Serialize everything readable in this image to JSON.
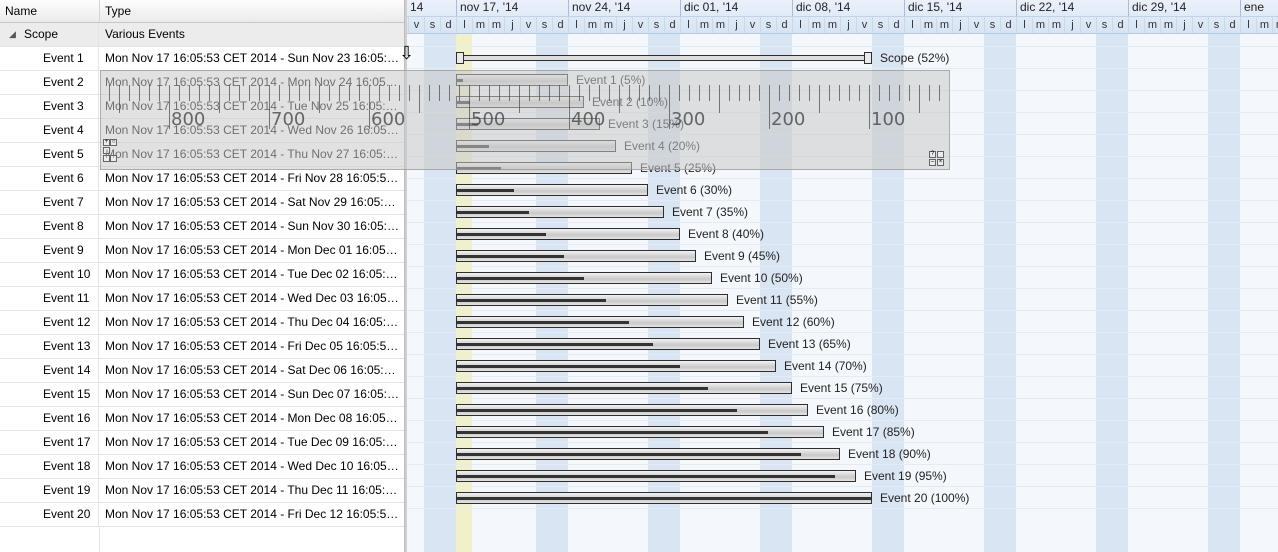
{
  "grid": {
    "columns": {
      "name": "Name",
      "type": "Type"
    },
    "summary": {
      "name": "Scope",
      "type": "Various Events"
    },
    "rows": [
      {
        "name": "Event 1",
        "type": "Mon Nov 17 16:05:53 CET 2014 - Sun Nov 23 16:05:53 ..."
      },
      {
        "name": "Event 2",
        "type": "Mon Nov 17 16:05:53 CET 2014 - Mon Nov 24 16:05:53..."
      },
      {
        "name": "Event 3",
        "type": "Mon Nov 17 16:05:53 CET 2014 - Tue Nov 25 16:05:53 ..."
      },
      {
        "name": "Event 4",
        "type": "Mon Nov 17 16:05:53 CET 2014 - Wed Nov 26 16:05:53 ..."
      },
      {
        "name": "Event 5",
        "type": "Mon Nov 17 16:05:53 CET 2014 - Thu Nov 27 16:05:53 ..."
      },
      {
        "name": "Event 6",
        "type": "Mon Nov 17 16:05:53 CET 2014 - Fri Nov 28 16:05:53 C..."
      },
      {
        "name": "Event 7",
        "type": "Mon Nov 17 16:05:53 CET 2014 - Sat Nov 29 16:05:53 ..."
      },
      {
        "name": "Event 8",
        "type": "Mon Nov 17 16:05:53 CET 2014 - Sun Nov 30 16:05:53 ..."
      },
      {
        "name": "Event 9",
        "type": "Mon Nov 17 16:05:53 CET 2014 - Mon Dec 01 16:05:53 ..."
      },
      {
        "name": "Event 10",
        "type": "Mon Nov 17 16:05:53 CET 2014 - Tue Dec 02 16:05:53 ..."
      },
      {
        "name": "Event 11",
        "type": "Mon Nov 17 16:05:53 CET 2014 - Wed Dec 03 16:05:53 ..."
      },
      {
        "name": "Event 12",
        "type": "Mon Nov 17 16:05:53 CET 2014 - Thu Dec 04 16:05:53 ..."
      },
      {
        "name": "Event 13",
        "type": "Mon Nov 17 16:05:53 CET 2014 - Fri Dec 05 16:05:53 C..."
      },
      {
        "name": "Event 14",
        "type": "Mon Nov 17 16:05:53 CET 2014 - Sat Dec 06 16:05:53 C..."
      },
      {
        "name": "Event 15",
        "type": "Mon Nov 17 16:05:53 CET 2014 - Sun Dec 07 16:05:53 ..."
      },
      {
        "name": "Event 16",
        "type": "Mon Nov 17 16:05:53 CET 2014 - Mon Dec 08 16:05:53 ..."
      },
      {
        "name": "Event 17",
        "type": "Mon Nov 17 16:05:53 CET 2014 - Tue Dec 09 16:05:53 ..."
      },
      {
        "name": "Event 18",
        "type": "Mon Nov 17 16:05:53 CET 2014 - Wed Dec 10 16:05:53 ..."
      },
      {
        "name": "Event 19",
        "type": "Mon Nov 17 16:05:53 CET 2014 - Thu Dec 11 16:05:53 ..."
      },
      {
        "name": "Event 20",
        "type": "Mon Nov 17 16:05:53 CET 2014 - Fri Dec 12 16:05:53 C..."
      }
    ]
  },
  "timeline": {
    "weeks": [
      "14",
      "nov 17, '14",
      "nov 24, '14",
      "dic 01, '14",
      "dic 08, '14",
      "dic 15, '14",
      "dic 22, '14",
      "dic 29, '14",
      "ene"
    ],
    "day_letters": [
      "l",
      "m",
      "m",
      "j",
      "v",
      "s",
      "d"
    ],
    "visible_start": "2014-11-13",
    "today": "2014-11-17"
  },
  "gantt": {
    "scope": {
      "label": "Scope (52%)",
      "start": "2014-11-17",
      "end": "2014-12-12",
      "progress": 0.52
    },
    "tasks": [
      {
        "label": "Event 1 (5%)",
        "start": "2014-11-17",
        "end": "2014-11-23",
        "progress": 0.05
      },
      {
        "label": "Event 2 (10%)",
        "start": "2014-11-17",
        "end": "2014-11-24",
        "progress": 0.1
      },
      {
        "label": "Event 3 (15%)",
        "start": "2014-11-17",
        "end": "2014-11-25",
        "progress": 0.15
      },
      {
        "label": "Event 4 (20%)",
        "start": "2014-11-17",
        "end": "2014-11-26",
        "progress": 0.2
      },
      {
        "label": "Event 5 (25%)",
        "start": "2014-11-17",
        "end": "2014-11-27",
        "progress": 0.25
      },
      {
        "label": "Event 6 (30%)",
        "start": "2014-11-17",
        "end": "2014-11-28",
        "progress": 0.3
      },
      {
        "label": "Event 7 (35%)",
        "start": "2014-11-17",
        "end": "2014-11-29",
        "progress": 0.35
      },
      {
        "label": "Event 8 (40%)",
        "start": "2014-11-17",
        "end": "2014-11-30",
        "progress": 0.4
      },
      {
        "label": "Event 9 (45%)",
        "start": "2014-11-17",
        "end": "2014-12-01",
        "progress": 0.45
      },
      {
        "label": "Event 10 (50%)",
        "start": "2014-11-17",
        "end": "2014-12-02",
        "progress": 0.5
      },
      {
        "label": "Event 11 (55%)",
        "start": "2014-11-17",
        "end": "2014-12-03",
        "progress": 0.55
      },
      {
        "label": "Event 12 (60%)",
        "start": "2014-11-17",
        "end": "2014-12-04",
        "progress": 0.6
      },
      {
        "label": "Event 13 (65%)",
        "start": "2014-11-17",
        "end": "2014-12-05",
        "progress": 0.65
      },
      {
        "label": "Event 14 (70%)",
        "start": "2014-11-17",
        "end": "2014-12-06",
        "progress": 0.7
      },
      {
        "label": "Event 15 (75%)",
        "start": "2014-11-17",
        "end": "2014-12-07",
        "progress": 0.75
      },
      {
        "label": "Event 16 (80%)",
        "start": "2014-11-17",
        "end": "2014-12-08",
        "progress": 0.8
      },
      {
        "label": "Event 17 (85%)",
        "start": "2014-11-17",
        "end": "2014-12-09",
        "progress": 0.85
      },
      {
        "label": "Event 18 (90%)",
        "start": "2014-11-17",
        "end": "2014-12-10",
        "progress": 0.9
      },
      {
        "label": "Event 19 (95%)",
        "start": "2014-11-17",
        "end": "2014-12-11",
        "progress": 0.95
      },
      {
        "label": "Event 20 (100%)",
        "start": "2014-11-17",
        "end": "2014-12-12",
        "progress": 1.0
      }
    ]
  },
  "ruler": {
    "labels": [
      "800",
      "700",
      "600",
      "500",
      "400",
      "300",
      "200",
      "100"
    ],
    "corner_icons": [
      "ruler-grid-icon",
      "ruler-close-icon"
    ]
  },
  "icons": {
    "expand": "collapse-triangle-icon",
    "drag": "down-arrow-drag-icon"
  },
  "colors": {
    "weekend": "#d9e5f2",
    "today": "#f1f0c8",
    "bar_border": "#2e2e2e",
    "progress": "#333333"
  }
}
